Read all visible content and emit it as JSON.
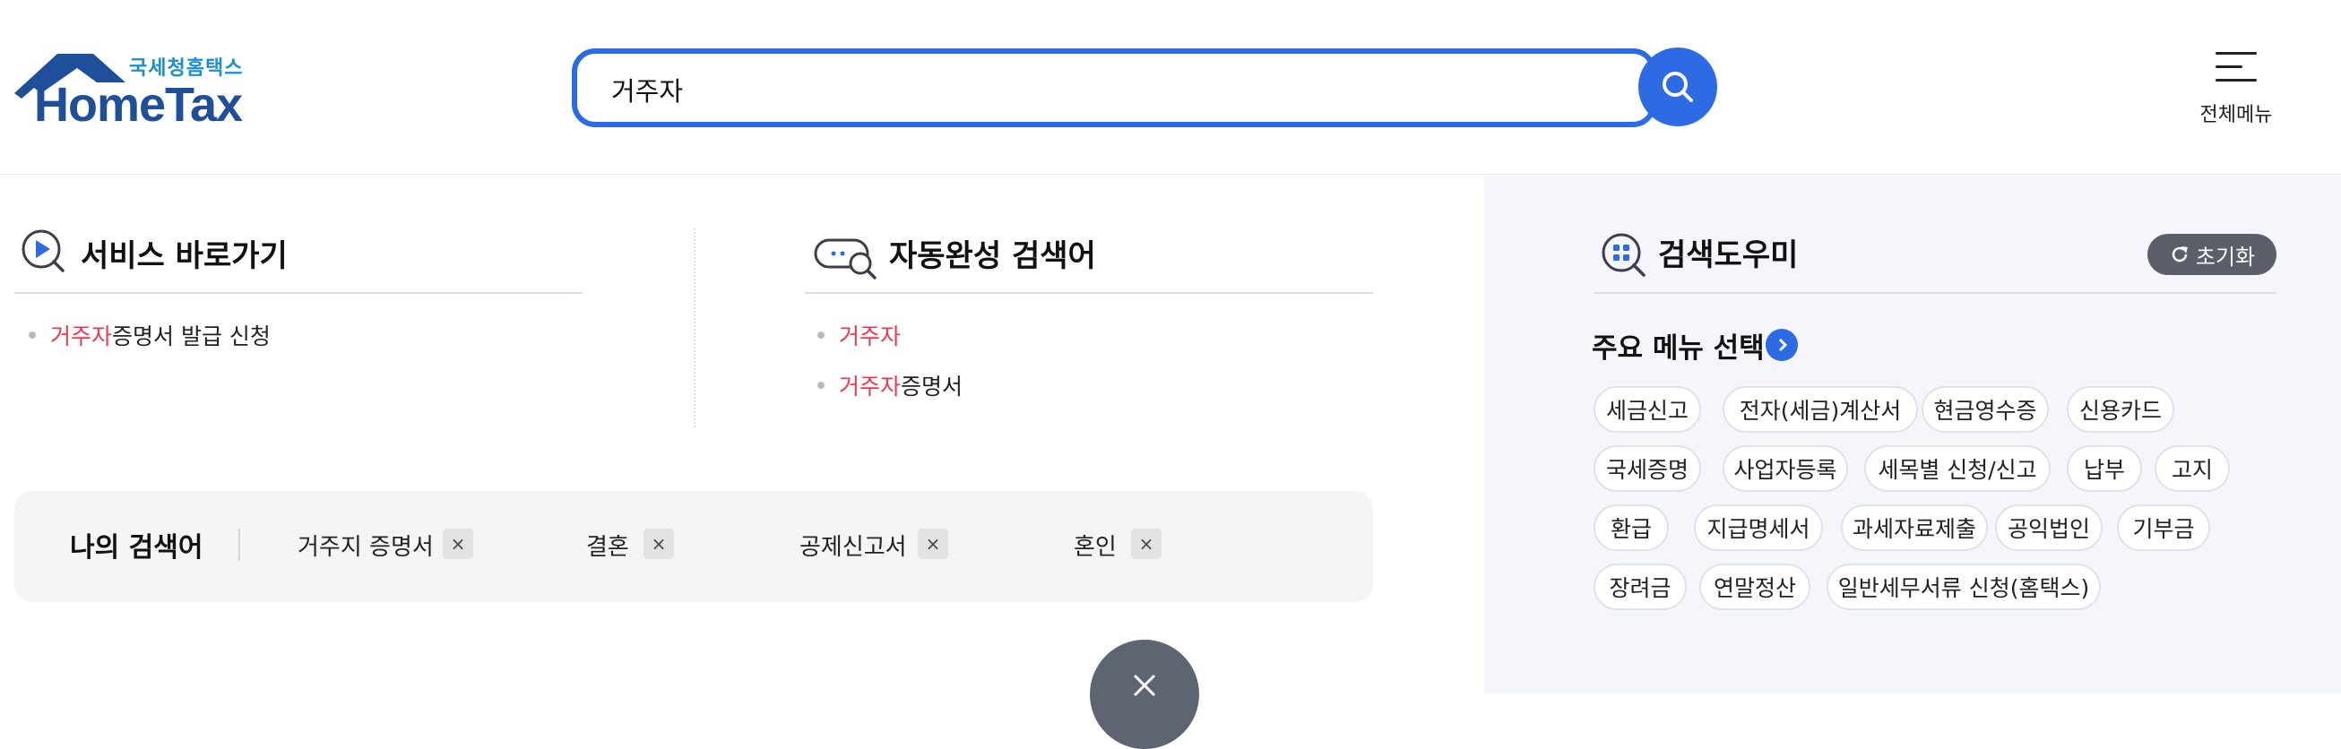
{
  "header": {
    "logo_sub": "국세청홈택스",
    "logo_main": "HomeTax",
    "search_value": "거주자",
    "all_menu_label": "전체메뉴"
  },
  "service_shortcut": {
    "title": "서비스 바로가기",
    "items": [
      {
        "highlight": "거주자",
        "rest": "증명서 발급 신청"
      }
    ]
  },
  "autocomplete": {
    "title": "자동완성 검색어",
    "items": [
      {
        "highlight": "거주자",
        "rest": ""
      },
      {
        "highlight": "거주자",
        "rest": "증명서"
      }
    ]
  },
  "my_search": {
    "title": "나의 검색어",
    "keywords": [
      "거주지 증명서",
      "결혼",
      "공제신고서",
      "혼인"
    ],
    "remove_symbol": "×"
  },
  "search_helper": {
    "title": "검색도우미",
    "reset_label": "초기화",
    "sub_title": "주요 메뉴 선택",
    "tags": [
      "세금신고",
      "전자(세금)계산서",
      "현금영수증",
      "신용카드",
      "국세증명",
      "사업자등록",
      "세목별 신청/신고",
      "납부",
      "고지",
      "환급",
      "지급명세서",
      "과세자료제출",
      "공익법인",
      "기부금",
      "장려금",
      "연말정산",
      "일반세무서류 신청(홈택스)"
    ]
  },
  "colors": {
    "accent": "#2d6be4",
    "highlight": "#e8394f",
    "logo_blue": "#1f4e9a",
    "logo_teal": "#1a8fd0",
    "panel_bg": "#f4f6fb"
  },
  "icons": [
    "house-roof-icon",
    "search-icon",
    "hamburger-menu-icon",
    "play-search-icon",
    "chat-search-icon",
    "grid-search-icon",
    "refresh-icon",
    "chevron-right-icon",
    "close-icon"
  ]
}
